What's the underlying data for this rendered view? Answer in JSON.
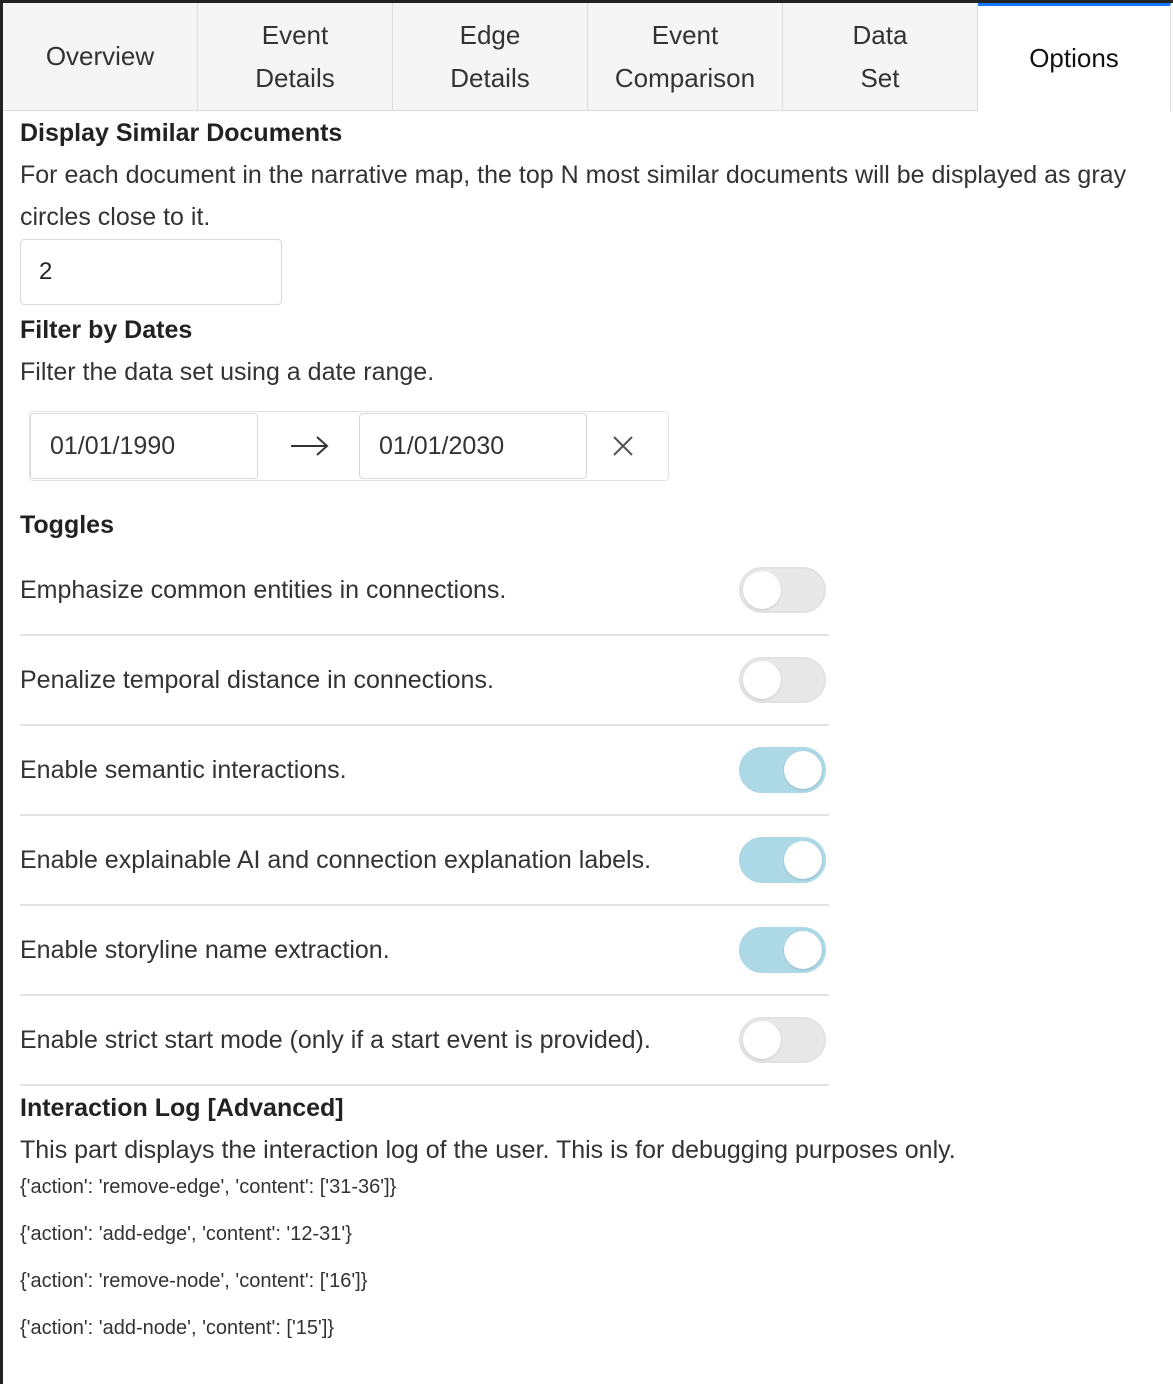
{
  "tabs": [
    {
      "label": "Overview"
    },
    {
      "label_line1": "Event",
      "label_line2": "Details"
    },
    {
      "label_line1": "Edge",
      "label_line2": "Details"
    },
    {
      "label_line1": "Event",
      "label_line2": "Comparison"
    },
    {
      "label_line1": "Data",
      "label_line2": "Set"
    },
    {
      "label": "Options",
      "active": true
    }
  ],
  "similar_docs": {
    "title": "Display Similar Documents",
    "description": "For each document in the narrative map, the top N most similar documents will be displayed as gray circles close to it.",
    "value": "2"
  },
  "date_filter": {
    "title": "Filter by Dates",
    "description": "Filter the data set using a date range.",
    "start": "01/01/1990",
    "end": "01/01/2030",
    "arrow_icon": "arrow-right-icon",
    "clear_icon": "close-icon"
  },
  "toggles": {
    "title": "Toggles",
    "accent_color": "#add8e6",
    "items": [
      {
        "label": "Emphasize common entities in connections.",
        "on": false
      },
      {
        "label": "Penalize temporal distance in connections.",
        "on": false
      },
      {
        "label": "Enable semantic interactions.",
        "on": true
      },
      {
        "label": "Enable explainable AI and connection explanation labels.",
        "on": true
      },
      {
        "label": "Enable storyline name extraction.",
        "on": true
      },
      {
        "label": "Enable strict start mode (only if a start event is provided).",
        "on": false
      }
    ]
  },
  "interaction_log": {
    "title": "Interaction Log [Advanced]",
    "description": "This part displays the interaction log of the user. This is for debugging purposes only.",
    "entries": [
      "{'action': 'remove-edge', 'content': ['31-36']}",
      "{'action': 'add-edge', 'content': '12-31'}",
      "{'action': 'remove-node', 'content': ['16']}",
      "{'action': 'add-node', 'content': ['15']}"
    ]
  }
}
